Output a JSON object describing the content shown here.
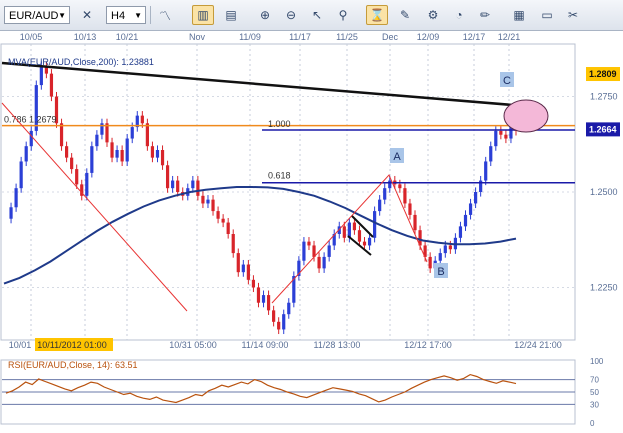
{
  "toolbar": {
    "symbol": "EUR/AUD",
    "timeframe": "H4",
    "icons": [
      "symbol-dropdown",
      "remove-chart-icon",
      "timeframe-dropdown",
      "line-chart-icon",
      "bar-chart-icon",
      "candle-chart-icon",
      "zoom-in-icon",
      "zoom-out-icon",
      "cursor-icon",
      "search-icon",
      "fibonacci-icon",
      "draw-icon",
      "settings-icon",
      "gauge-icon",
      "pencil-icon",
      "indicator-icon",
      "window-icon",
      "tools-icon"
    ]
  },
  "colors": {
    "candle_up": "#2b3fd6",
    "candle_down": "#d8242a",
    "mva": "#1f3a8a",
    "trendline": "#111111",
    "fib_line": "#1a1aa8",
    "orange_line": "#f08a1c",
    "red_line": "#e83434",
    "circle_fill": "#f4b8d8",
    "rsi_line": "#b9520e",
    "price_highlight": "#ffc400"
  },
  "chart_data": [
    {
      "type": "candlestick",
      "title": "",
      "indicator_label": "MVA(EUR/AUD,Close,200): 1.23881",
      "top_axis": [
        "10/05",
        "10/13",
        "10/21",
        "Nov",
        "11/09",
        "11/17",
        "11/25",
        "Dec",
        "12/09",
        "12/17",
        "12/21"
      ],
      "bottom_axis": [
        "10/01",
        "10/11/2012 01:00",
        "10/31 05:00",
        "11/14 09:00",
        "11/28 13:00",
        "12/12 17:00",
        "12/24 21:00"
      ],
      "y_ticks": [
        1.275,
        1.25,
        1.225
      ],
      "y_tick_labels": [
        "1.2750",
        "1.2500",
        "1.2250"
      ],
      "ylim": [
        1.2115,
        1.2885
      ],
      "price_tags": [
        {
          "label": "1.2809",
          "value": 1.2809,
          "style": "orange"
        },
        {
          "label": "1.2664",
          "value": 1.2664,
          "style": "blue"
        }
      ],
      "fib_levels": [
        {
          "label": "1.000",
          "value": 1.2673
        },
        {
          "label": "0.618",
          "value": 1.2527
        },
        {
          "label": "0.786 1.2679",
          "value": 1.2679
        }
      ],
      "annotations": [
        {
          "label": "A",
          "value": 1.2545
        },
        {
          "label": "B",
          "value": 1.2275
        },
        {
          "label": "C",
          "value": 1.2785
        }
      ],
      "close_path": [
        1.243,
        1.246,
        1.251,
        1.258,
        1.262,
        1.266,
        1.278,
        1.283,
        1.281,
        1.275,
        1.268,
        1.262,
        1.259,
        1.256,
        1.252,
        1.249,
        1.255,
        1.262,
        1.265,
        1.268,
        1.263,
        1.259,
        1.261,
        1.258,
        1.264,
        1.267,
        1.27,
        1.268,
        1.262,
        1.259,
        1.261,
        1.257,
        1.251,
        1.253,
        1.25,
        1.249,
        1.251,
        1.253,
        1.249,
        1.247,
        1.248,
        1.245,
        1.243,
        1.242,
        1.239,
        1.234,
        1.229,
        1.231,
        1.227,
        1.225,
        1.221,
        1.223,
        1.219,
        1.216,
        1.214,
        1.218,
        1.221,
        1.228,
        1.232,
        1.237,
        1.236,
        1.233,
        1.23,
        1.233,
        1.236,
        1.239,
        1.241,
        1.238,
        1.242,
        1.24,
        1.237,
        1.236,
        1.238,
        1.245,
        1.248,
        1.251,
        1.253,
        1.252,
        1.251,
        1.247,
        1.244,
        1.24,
        1.236,
        1.233,
        1.23,
        1.232,
        1.234,
        1.236,
        1.235,
        1.238,
        1.241,
        1.244,
        1.247,
        1.25,
        1.253,
        1.258,
        1.262,
        1.266,
        1.265,
        1.264,
        1.267,
        1.266
      ],
      "mva_path": [
        1.226,
        1.2275,
        1.2295,
        1.2318,
        1.2345,
        1.2372,
        1.2398,
        1.2422,
        1.2443,
        1.2462,
        1.2478,
        1.249,
        1.25,
        1.2506,
        1.251,
        1.2513,
        1.2513,
        1.2512,
        1.2508,
        1.25,
        1.249,
        1.2475,
        1.2458,
        1.2438,
        1.2418,
        1.24,
        1.2385,
        1.2373,
        1.2367,
        1.2363,
        1.2363,
        1.2365,
        1.237,
        1.2378
      ],
      "rsi": {
        "label": "RSI(EUR/AUD,Close, 14): 63.51",
        "value": 63.51,
        "levels": [
          70,
          50,
          30
        ],
        "scale_labels": [
          "100",
          "70",
          "50",
          "30",
          "0"
        ],
        "path": [
          48,
          52,
          58,
          66,
          62,
          71,
          67,
          63,
          59,
          55,
          52,
          57,
          61,
          66,
          64,
          58,
          54,
          50,
          46,
          48,
          43,
          40,
          38,
          42,
          37,
          35,
          33,
          37,
          41,
          46,
          44,
          52,
          56,
          61,
          58,
          62,
          66,
          63,
          70,
          67,
          61,
          57,
          54,
          50,
          47,
          43,
          41,
          45,
          49,
          53,
          57,
          55,
          53,
          51,
          47,
          44,
          39,
          34,
          37,
          42,
          46,
          50,
          56,
          61,
          66,
          70,
          73,
          76,
          73,
          69,
          72,
          78,
          75,
          70,
          67,
          64,
          68,
          66,
          63.51
        ]
      }
    }
  ]
}
